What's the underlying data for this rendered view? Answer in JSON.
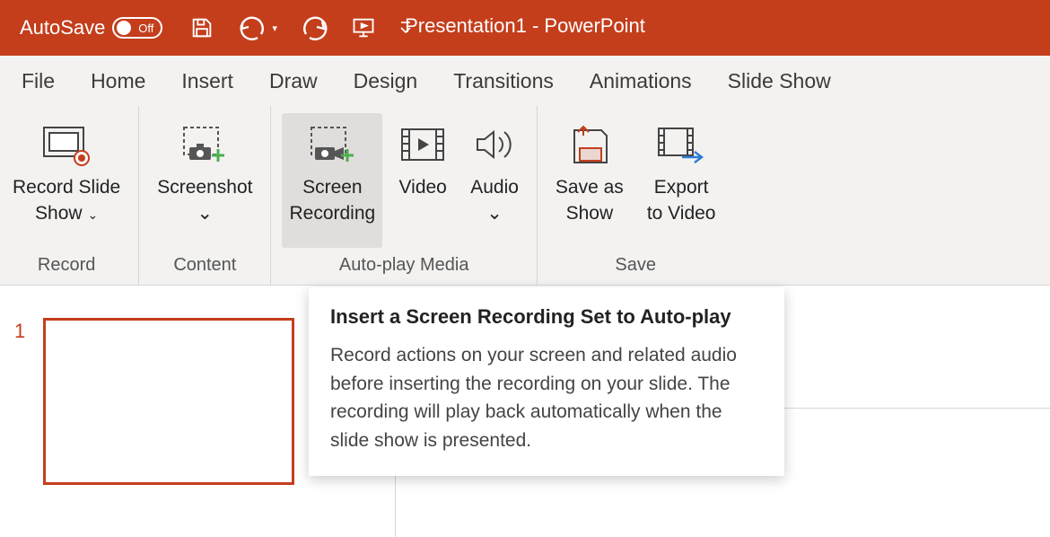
{
  "titlebar": {
    "autosave_label": "AutoSave",
    "autosave_state": "Off",
    "title_filename": "Presentation1",
    "title_separator": " - ",
    "title_app": "PowerPoint"
  },
  "tabs": [
    "File",
    "Home",
    "Insert",
    "Draw",
    "Design",
    "Transitions",
    "Animations",
    "Slide Show"
  ],
  "ribbon": {
    "groups": [
      {
        "label": "Record",
        "items": [
          {
            "line1": "Record Slide",
            "line2": "Show",
            "dropdown": true,
            "name": "record-slide-show-button",
            "icon": "record-slide-icon"
          }
        ]
      },
      {
        "label": "Content",
        "items": [
          {
            "line1": "Screenshot",
            "line2": "",
            "dropdown": true,
            "name": "screenshot-button",
            "icon": "screenshot-icon"
          }
        ]
      },
      {
        "label": "Auto-play Media",
        "items": [
          {
            "line1": "Screen",
            "line2": "Recording",
            "dropdown": false,
            "name": "screen-recording-button",
            "icon": "screen-recording-icon",
            "hover": true
          },
          {
            "line1": "Video",
            "line2": "",
            "dropdown": false,
            "name": "video-button",
            "icon": "video-icon"
          },
          {
            "line1": "Audio",
            "line2": "",
            "dropdown": true,
            "name": "audio-button",
            "icon": "audio-icon"
          }
        ]
      },
      {
        "label": "Save",
        "items": [
          {
            "line1": "Save as",
            "line2": "Show",
            "dropdown": false,
            "name": "save-as-show-button",
            "icon": "save-as-show-icon"
          },
          {
            "line1": "Export",
            "line2": "to Video",
            "dropdown": false,
            "name": "export-to-video-button",
            "icon": "export-video-icon"
          }
        ]
      }
    ]
  },
  "slide": {
    "number": "1"
  },
  "tooltip": {
    "title": "Insert a Screen Recording Set to Auto-play",
    "body": "Record actions on your screen and related audio before inserting the recording on your slide. The recording will play back automatically when the slide show is presented."
  }
}
